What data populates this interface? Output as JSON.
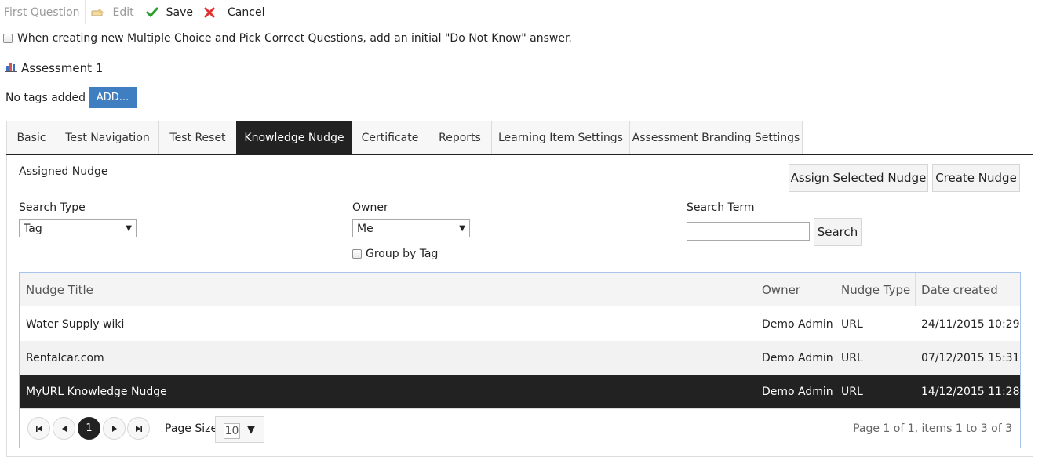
{
  "toolbar": {
    "first_question": "First Question",
    "edit": "Edit",
    "save": "Save",
    "cancel": "Cancel"
  },
  "do_not_know_option": {
    "label": "When creating new Multiple Choice and Pick Correct Questions, add an initial \"Do Not Know\" answer.",
    "checked": false
  },
  "assessment": {
    "title": "Assessment 1",
    "icon": "bar-chart-icon"
  },
  "tags": {
    "empty_text": "No tags added",
    "add_label": "ADD..."
  },
  "tabs": [
    {
      "label": "Basic",
      "active": false
    },
    {
      "label": "Test Navigation",
      "active": false
    },
    {
      "label": "Test Reset",
      "active": false
    },
    {
      "label": "Knowledge Nudge",
      "active": true
    },
    {
      "label": "Certificate",
      "active": false
    },
    {
      "label": "Reports",
      "active": false
    },
    {
      "label": "Learning Item Settings",
      "active": false
    },
    {
      "label": "Assessment Branding Settings",
      "active": false
    }
  ],
  "nudge": {
    "assigned_label": "Assigned Nudge",
    "assign_button": "Assign Selected Nudge",
    "create_button": "Create Nudge",
    "search_type": {
      "label": "Search Type",
      "value": "Tag"
    },
    "owner": {
      "label": "Owner",
      "value": "Me"
    },
    "group_by_tag": {
      "label": "Group by Tag",
      "checked": false
    },
    "search_term": {
      "label": "Search Term",
      "value": "",
      "button": "Search"
    }
  },
  "grid": {
    "columns": [
      "Nudge Title",
      "Owner",
      "Nudge Type",
      "Date created"
    ],
    "rows": [
      {
        "title": "Water Supply wiki",
        "owner": "Demo Admin",
        "type": "URL",
        "date": "24/11/2015 10:29",
        "selected": false
      },
      {
        "title": "Rentalcar.com",
        "owner": "Demo Admin",
        "type": "URL",
        "date": "07/12/2015 15:31",
        "selected": false
      },
      {
        "title": "MyURL Knowledge Nudge",
        "owner": "Demo Admin",
        "type": "URL",
        "date": "14/12/2015 11:28",
        "selected": true
      }
    ],
    "pager": {
      "current_page": "1",
      "page_size_label": "Page Size",
      "page_size": "10",
      "info": "Page 1 of 1, items 1 to 3 of 3"
    }
  },
  "colors": {
    "accent_blue": "#3f7fc1",
    "active_tab": "#222222",
    "selected_row": "#222222",
    "save_check": "#2a9d2a",
    "cancel_x": "#e03030"
  }
}
